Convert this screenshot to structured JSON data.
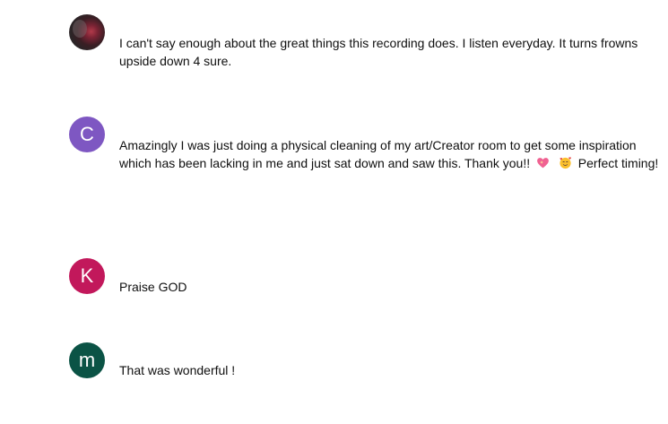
{
  "comments": [
    {
      "avatar": {
        "type": "photo",
        "letter": "",
        "color": "#5a2a33"
      },
      "text": "I can't say enough about the great things this recording does. I listen everyday. It turns frowns upside down 4 sure."
    },
    {
      "avatar": {
        "type": "letter",
        "letter": "C",
        "color": "#7e57c2"
      },
      "text_before": "Amazingly I was just doing a physical cleaning of my art/Creator room to get some inspiration which has been lacking in me and just sat down and saw this. Thank you!!",
      "emoji_1": "sparkling-heart-icon",
      "emoji_2": "smiling-face-with-hearts-icon",
      "text_after": "Perfect timing!"
    },
    {
      "avatar": {
        "type": "letter",
        "letter": "K",
        "color": "#c2185b"
      },
      "text": "Praise GOD"
    },
    {
      "avatar": {
        "type": "letter",
        "letter": "m",
        "color": "#0b5345"
      },
      "text": "That was wonderful !"
    }
  ]
}
